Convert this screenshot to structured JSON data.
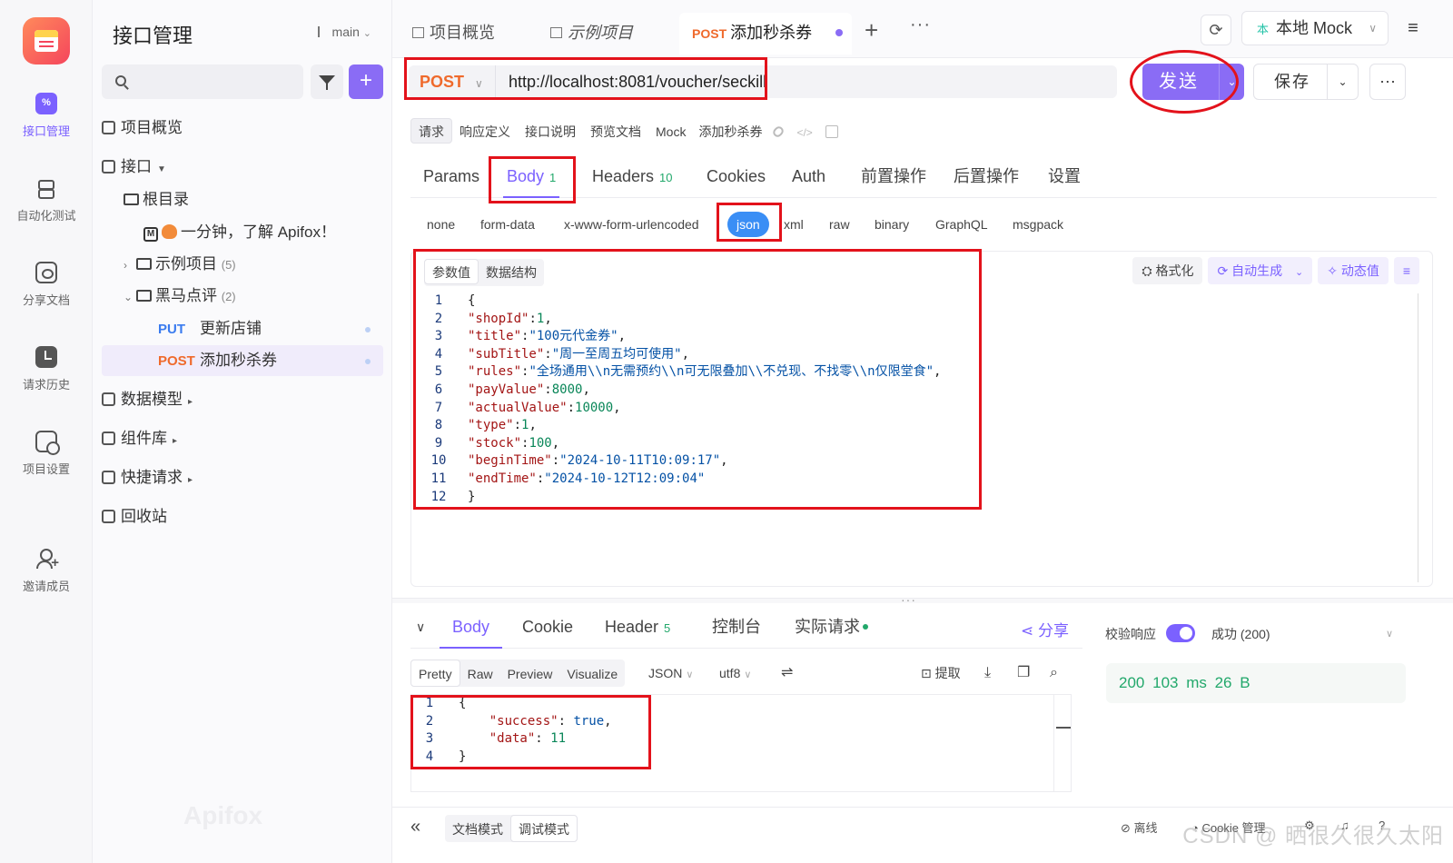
{
  "rail": {
    "items": [
      {
        "label": "接口管理",
        "icon": "api-icon",
        "active": true
      },
      {
        "label": "自动化测试",
        "icon": "automation-icon"
      },
      {
        "label": "分享文档",
        "icon": "share-doc-icon"
      },
      {
        "label": "请求历史",
        "icon": "history-icon"
      },
      {
        "label": "项目设置",
        "icon": "settings-icon"
      },
      {
        "label": "邀请成员",
        "icon": "invite-member-icon"
      }
    ]
  },
  "tree": {
    "title": "接口管理",
    "branch": "main",
    "overview": "项目概览",
    "api": "接口",
    "root": "根目录",
    "intro_doc": "一分钟，了解 Apifox！",
    "example": {
      "label": "示例项目",
      "count": "(5)"
    },
    "heima": {
      "label": "黑马点评",
      "count": "(2)"
    },
    "endpoints": [
      {
        "method": "PUT",
        "name": "更新店铺"
      },
      {
        "method": "POST",
        "name": "添加秒杀券"
      }
    ],
    "data_model": "数据模型",
    "components": "组件库",
    "quick_request": "快捷请求",
    "recycle": "回收站",
    "watermark": "Apifox"
  },
  "tabs": {
    "items": [
      {
        "label": "项目概览"
      },
      {
        "label": "示例项目"
      },
      {
        "method": "POST",
        "label": "添加秒杀券"
      }
    ],
    "plus": "+",
    "more": "···"
  },
  "topright": {
    "env": "本地 Mock",
    "env_badge": "本",
    "refresh": "⟳",
    "menu": "≡"
  },
  "request": {
    "method": "POST",
    "url": "http://localhost:8081/voucher/seckill",
    "send": "发送",
    "save": "保存",
    "more": "···"
  },
  "subtabs": {
    "items": [
      "请求",
      "响应定义",
      "接口说明",
      "预览文档",
      "Mock"
    ],
    "name": "添加秒杀券"
  },
  "reqtabs": {
    "params": "Params",
    "body": "Body",
    "body_badge": "1",
    "headers": "Headers",
    "headers_badge": "10",
    "cookies": "Cookies",
    "auth": "Auth",
    "pre": "前置操作",
    "post": "后置操作",
    "settings": "设置"
  },
  "bodytypes": [
    "none",
    "form-data",
    "x-www-form-urlencoded",
    "json",
    "xml",
    "raw",
    "binary",
    "GraphQL",
    "msgpack"
  ],
  "editor": {
    "tabs": [
      "参数值",
      "数据结构"
    ],
    "tools": {
      "format": "格式化",
      "autogen": "自动生成",
      "dynamic": "动态值",
      "wrap_icon": "wrap-icon"
    },
    "lines": [
      {
        "n": "1",
        "open": "{"
      },
      {
        "n": "2",
        "key": "\"shopId\"",
        "num": "1"
      },
      {
        "n": "3",
        "key": "\"title\"",
        "str": "\"100元代金券\""
      },
      {
        "n": "4",
        "key": "\"subTitle\"",
        "str": "\"周一至周五均可使用\""
      },
      {
        "n": "5",
        "key": "\"rules\"",
        "str": "\"全场通用\\\\n无需预约\\\\n可无限叠加\\\\不兑现、不找零\\\\n仅限堂食\""
      },
      {
        "n": "6",
        "key": "\"payValue\"",
        "num": "8000"
      },
      {
        "n": "7",
        "key": "\"actualValue\"",
        "num": "10000"
      },
      {
        "n": "8",
        "key": "\"type\"",
        "num": "1"
      },
      {
        "n": "9",
        "key": "\"stock\"",
        "num": "100"
      },
      {
        "n": "10",
        "key": "\"beginTime\"",
        "str": "\"2024-10-11T10:09:17\""
      },
      {
        "n": "11",
        "key": "\"endTime\"",
        "str": "\"2024-10-12T12:09:04\"",
        "last": true
      },
      {
        "n": "12",
        "open": "}"
      }
    ]
  },
  "response": {
    "tabs": {
      "body": "Body",
      "cookie": "Cookie",
      "header": "Header",
      "header_badge": "5",
      "console": "控制台",
      "actual": "实际请求"
    },
    "share": "分享",
    "views": [
      "Pretty",
      "Raw",
      "Preview",
      "Visualize"
    ],
    "format": "JSON",
    "encoding": "utf8",
    "extract": "提取",
    "lines": [
      {
        "n": "1",
        "text": "{"
      },
      {
        "n": "2",
        "key": "\"success\"",
        "val": "true"
      },
      {
        "n": "3",
        "key": "\"data\"",
        "val": "11"
      },
      {
        "n": "4",
        "text": "}"
      }
    ],
    "validate_label": "校验响应",
    "validate_on": true,
    "result": "成功 (200)",
    "status": "200",
    "time": "103 ms",
    "size": "26 B"
  },
  "footer": {
    "modes": [
      "文档模式",
      "调试模式"
    ],
    "offline": "离线",
    "cookie_mgr": "Cookie 管理",
    "collapse": "«"
  },
  "watermark": "CSDN @ 晒很久很久太阳",
  "colors": {
    "accent": "#7b61ff",
    "post": "#ef6a2c",
    "put": "#3a7bef",
    "annotation": "#e3121b",
    "success": "#22a86b"
  }
}
